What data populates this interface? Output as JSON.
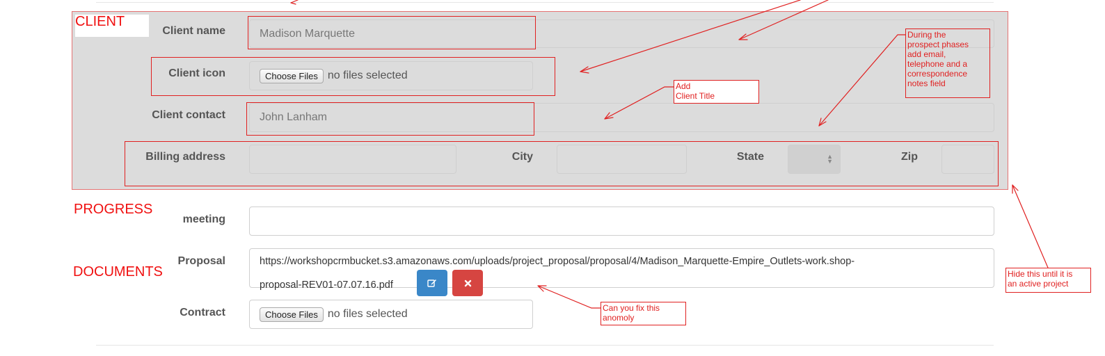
{
  "sections": {
    "client": "CLIENT",
    "progress": "PROGRESS",
    "documents": "DOCUMENTS"
  },
  "client": {
    "name_label": "Client name",
    "name_value": "Madison Marquette",
    "icon_label": "Client icon",
    "icon_button": "Choose Files",
    "icon_status": "no files selected",
    "contact_label": "Client contact",
    "contact_value": "John Lanham",
    "billing_label": "Billing address",
    "billing_value": "",
    "city_label": "City",
    "city_value": "",
    "state_label": "State",
    "zip_label": "Zip",
    "zip_value": ""
  },
  "progress": {
    "meeting_label": "meeting",
    "meeting_value": ""
  },
  "documents": {
    "proposal_label": "Proposal",
    "proposal_line1": "https://workshopcrmbucket.s3.amazonaws.com/uploads/project_proposal/proposal/4/Madison_Marquette-Empire_Outlets-work.shop-",
    "proposal_line2": "proposal-REV01-07.07.16.pdf",
    "contract_label": "Contract",
    "contract_button": "Choose Files",
    "contract_status": "no files selected"
  },
  "notes": {
    "client_title_line1": "Add",
    "client_title_line2": "Client Title",
    "prospect_line1": "During the",
    "prospect_line2": "prospect phases",
    "prospect_line3": "add email,",
    "prospect_line4": "telephone and a",
    "prospect_line5": "correspondence",
    "prospect_line6": "notes field",
    "hide_line1": "Hide this until it is",
    "hide_line2": "an active project",
    "fix_line1": "Can you fix this",
    "fix_line2": "anomoly"
  },
  "colors": {
    "annotation": "#e02020",
    "panel": "#dcdcdc",
    "edit_button": "#3a87c8",
    "delete_button": "#d64541"
  },
  "icons": {
    "edit": "edit-icon",
    "delete": "close-icon",
    "state_select": "updown-caret-icon"
  }
}
